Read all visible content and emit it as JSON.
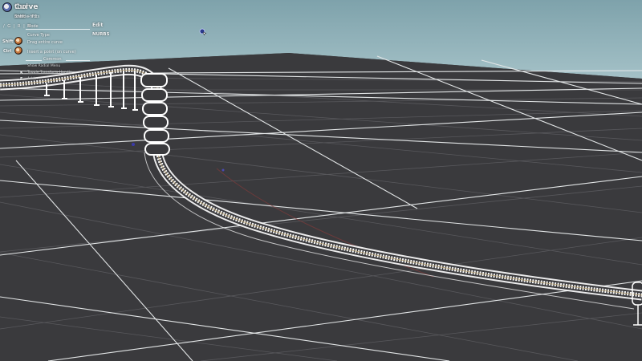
{
  "tool": {
    "name": "Curve",
    "suffix": " tool",
    "hint_prefix": "Press ",
    "hint_keys": "Shift + F1",
    "hint_suffix": " to hide hints"
  },
  "mode": {
    "keys": "/ G | R | O",
    "label": "Mode",
    "value": "Edit"
  },
  "curve_type": {
    "label": "Curve Type",
    "value": "NURBS"
  },
  "modifiers": [
    {
      "key": "Shift",
      "action": "Drag entire curve"
    },
    {
      "key": "Ctrl",
      "action": "Insert a point (on curve)"
    }
  ],
  "common": {
    "title": "Common",
    "shortcuts": [
      {
        "key": "",
        "action": "Show Radial Menu"
      },
      {
        "key": "K",
        "action": "Toggle Transform Handle"
      },
      {
        "key": "F",
        "action": "Add..."
      }
    ]
  },
  "colors": {
    "sky": "#8fb1b9",
    "ground": "#3a3a3d",
    "grid": "#e6e9ea",
    "curve": "#ffffff"
  },
  "icons": [
    "curve-tool-icon",
    "mouse-icon",
    "cursor-icon"
  ]
}
